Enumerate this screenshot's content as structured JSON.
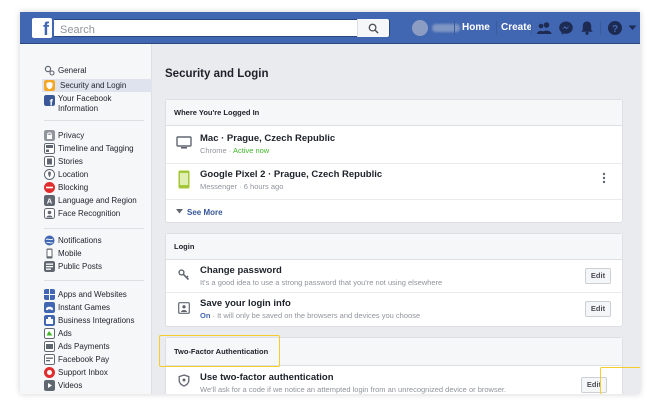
{
  "topbar": {
    "search_placeholder": "Search",
    "nav": {
      "home": "Home",
      "create": "Create"
    },
    "icons": [
      "friends-icon",
      "messenger-icon",
      "notifications-icon",
      "help-icon",
      "chevron-down-icon"
    ]
  },
  "sidebar": {
    "groups": [
      [
        {
          "label": "General",
          "icon": "gear-icon"
        },
        {
          "label": "Security and Login",
          "icon": "shield-icon",
          "selected": true
        },
        {
          "label": "Your Facebook Information",
          "icon": "facebook-icon"
        }
      ],
      [
        {
          "label": "Privacy",
          "icon": "lock-icon"
        },
        {
          "label": "Timeline and Tagging",
          "icon": "timeline-icon"
        },
        {
          "label": "Stories",
          "icon": "stories-icon"
        },
        {
          "label": "Location",
          "icon": "location-icon"
        },
        {
          "label": "Blocking",
          "icon": "blocking-icon"
        },
        {
          "label": "Language and Region",
          "icon": "language-icon"
        },
        {
          "label": "Face Recognition",
          "icon": "face-recognition-icon"
        }
      ],
      [
        {
          "label": "Notifications",
          "icon": "globe-icon"
        },
        {
          "label": "Mobile",
          "icon": "mobile-icon"
        },
        {
          "label": "Public Posts",
          "icon": "public-posts-icon"
        }
      ],
      [
        {
          "label": "Apps and Websites",
          "icon": "apps-icon"
        },
        {
          "label": "Instant Games",
          "icon": "games-icon"
        },
        {
          "label": "Business Integrations",
          "icon": "business-icon"
        },
        {
          "label": "Ads",
          "icon": "ads-icon"
        },
        {
          "label": "Ads Payments",
          "icon": "payments-icon"
        },
        {
          "label": "Facebook Pay",
          "icon": "pay-icon"
        },
        {
          "label": "Support Inbox",
          "icon": "support-icon"
        },
        {
          "label": "Videos",
          "icon": "videos-icon"
        }
      ]
    ]
  },
  "main": {
    "title": "Security and Login",
    "logged_in": {
      "header": "Where You're Logged In",
      "sessions": [
        {
          "device": "Mac · Prague, Czech Republic",
          "app": "Chrome",
          "sep": " · ",
          "status": "Active now"
        },
        {
          "device": "Google Pixel 2 · Prague, Czech Republic",
          "app": "Messenger",
          "sep": " · ",
          "status": "6 hours ago"
        }
      ],
      "see_more": "See More"
    },
    "login": {
      "header": "Login",
      "items": [
        {
          "title": "Change password",
          "subtitle": "It's a good idea to use a strong password that you're not using elsewhere",
          "button": "Edit"
        },
        {
          "title": "Save your login info",
          "status": "On",
          "subtitle": " · It will only be saved on the browsers and devices you choose",
          "button": "Edit"
        }
      ]
    },
    "two_factor": {
      "header": "Two-Factor Authentication",
      "items": [
        {
          "title": "Use two-factor authentication",
          "subtitle": "We'll ask for a code if we notice an attempted login from an unrecognized device or browser.",
          "button": "Edit"
        }
      ]
    }
  },
  "colors": {
    "brand": "#4267b2",
    "link": "#365899",
    "active": "#42b72a",
    "highlight": "#f4cd2a",
    "selected_bg": "#dfe3ee"
  }
}
